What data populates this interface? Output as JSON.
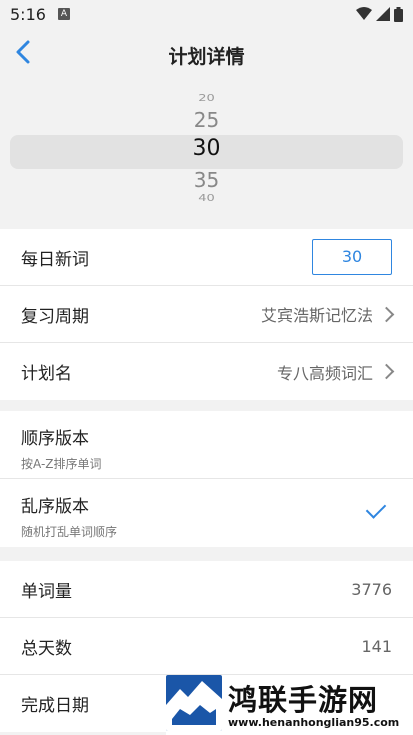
{
  "status": {
    "time": "5:16",
    "notif_letter": "A"
  },
  "nav": {
    "title": "计划详情"
  },
  "picker": {
    "values": [
      "20",
      "25",
      "30",
      "35",
      "40"
    ],
    "selected": "30"
  },
  "settings": {
    "daily_label": "每日新词",
    "daily_value": "30",
    "review_label": "复习周期",
    "review_value": "艾宾浩斯记忆法",
    "plan_label": "计划名",
    "plan_value": "专八高频词汇"
  },
  "order": {
    "seq_title": "顺序版本",
    "seq_sub": "按A-Z排序单词",
    "rand_title": "乱序版本",
    "rand_sub": "随机打乱单词顺序",
    "selected": "rand"
  },
  "stats": {
    "words_label": "单词量",
    "words_value": "3776",
    "days_label": "总天数",
    "days_value": "141",
    "finish_label": "完成日期"
  },
  "watermark": {
    "text": "鸿联手游网",
    "url": "www.henanhonglian95.com"
  },
  "colors": {
    "accent": "#2f86e0"
  }
}
